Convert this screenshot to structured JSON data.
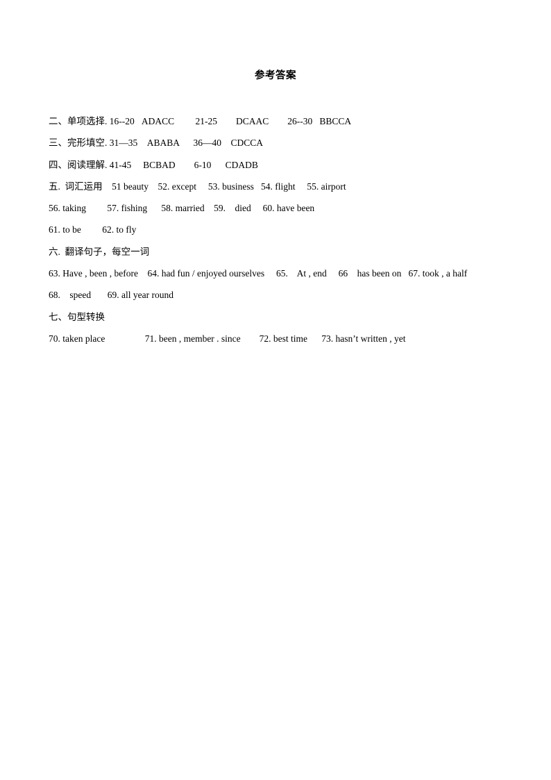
{
  "document": {
    "title": "参考答案",
    "page_background": "#ffffff",
    "text_color": "#000000",
    "answer_lines": [
      {
        "id": "line-1",
        "text": "二、单项选择. 16--20   ADACC         21-25        DCAAC        26--30   BBCCA"
      },
      {
        "id": "line-2",
        "text": "三、完形填空. 31—35    ABABA      36—40    CDCCA"
      },
      {
        "id": "line-3",
        "text": "四、阅读理解. 41-45     BCBAD        6-10      CDADB"
      },
      {
        "id": "line-4",
        "text": "五.  词汇运用    51 beauty    52. except     53. business   54. flight     55. airport"
      },
      {
        "id": "line-5",
        "text": "56. taking         57. fishing      58. married    59.    died     60. have been"
      },
      {
        "id": "line-6",
        "text": "61. to be         62. to fly"
      },
      {
        "id": "line-7",
        "text": "六.  翻译句子，每空一词"
      },
      {
        "id": "line-8",
        "text": "63. Have , been , before    64. had fun / enjoyed ourselves     65.    At , end     66    has been on   67. took , a half"
      },
      {
        "id": "line-9",
        "text": "68.    speed       69. all year round"
      },
      {
        "id": "line-10",
        "text": "七、句型转换"
      },
      {
        "id": "line-11",
        "text": "70. taken place                 71. been , member . since        72. best time      73. hasn’t written , yet"
      }
    ]
  }
}
